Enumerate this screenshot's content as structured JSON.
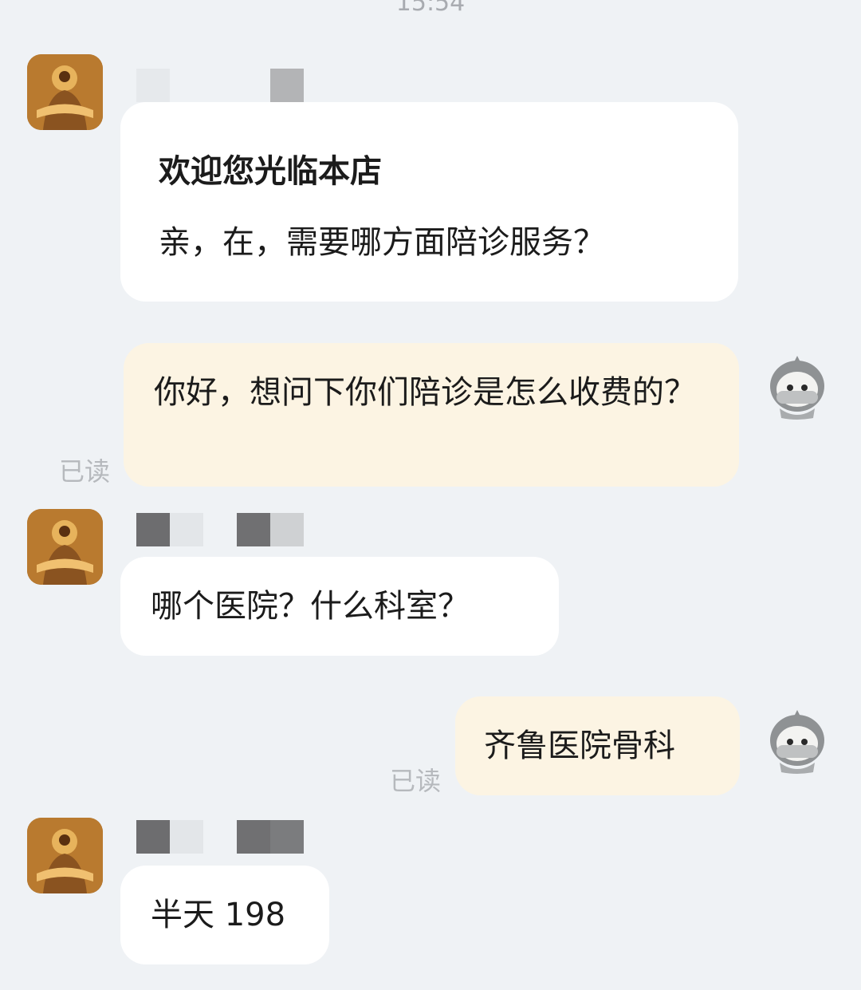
{
  "time": "15:54",
  "messages": [
    {
      "from": "shop",
      "title": "欢迎您光临本店",
      "text": "亲，在，需要哪方面陪诊服务？"
    },
    {
      "from": "user",
      "text": "你好，想问下你们陪诊是怎么收费的？",
      "status": "已读"
    },
    {
      "from": "shop",
      "text": "哪个医院？什么科室？"
    },
    {
      "from": "user",
      "text": "齐鲁医院骨科",
      "status": "已读"
    },
    {
      "from": "shop",
      "text": "半天 198"
    }
  ],
  "icons": {
    "shop_avatar": "shop-avatar-icon",
    "user_avatar": "user-avatar-icon"
  },
  "colors": {
    "background": "#eff2f5",
    "incoming_bubble": "#ffffff",
    "outgoing_bubble": "#fcf4e3",
    "read_text": "#b6b9bd"
  }
}
